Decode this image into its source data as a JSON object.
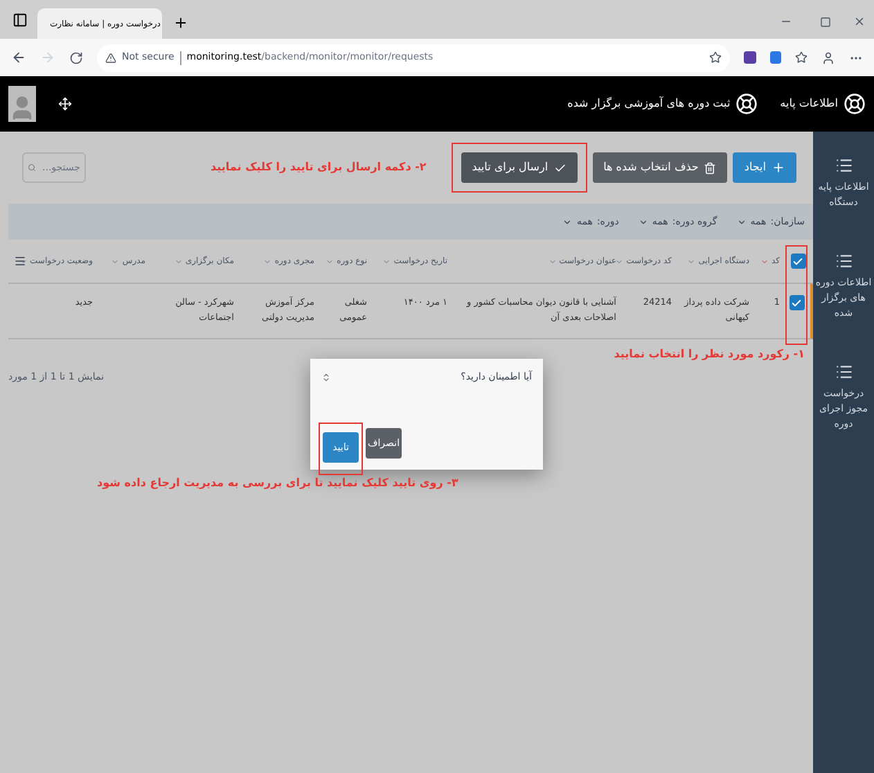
{
  "browser": {
    "tab_title": "درخواست دوره | سامانه نظارت",
    "security": "Not secure",
    "url_host": "monitoring.test",
    "url_path": "/backend/monitor/monitor/requests"
  },
  "header": {
    "nav": [
      {
        "label": "اطلاعات پایه"
      },
      {
        "label": "ثبت دوره های آموزشی برگزار شده"
      }
    ]
  },
  "toolbar": {
    "buttons": [
      {
        "kind": "create",
        "label": "ایجاد"
      },
      {
        "kind": "delete",
        "label": "حذف انتخاب شده ها"
      },
      {
        "kind": "send",
        "label": "ارسال برای تایید"
      }
    ],
    "annotation": "۲- دکمه ارسال برای تایید را کلیک نمایید",
    "search": {
      "placeholder": "جستجو..."
    }
  },
  "filters": [
    {
      "label": "سازمان:",
      "value": "همه"
    },
    {
      "label": "گروه دوره:",
      "value": "همه"
    },
    {
      "label": "دوره:",
      "value": "همه"
    }
  ],
  "table": {
    "all_checked": true,
    "columns": [
      {
        "label": "کد",
        "sorted": true
      },
      {
        "label": "دستگاه اجرایی",
        "sorted": false
      },
      {
        "label": "کد درخواست",
        "sorted": false
      },
      {
        "label": "عنوان درخواست",
        "sorted": false
      },
      {
        "label": "تاریخ درخواست",
        "sorted": false
      },
      {
        "label": "نوع دوره",
        "sorted": false
      },
      {
        "label": "مجری دوره",
        "sorted": false
      },
      {
        "label": "مکان برگزاری",
        "sorted": false
      },
      {
        "label": "مدرس",
        "sorted": false
      },
      {
        "label": "وضعیت درخواست",
        "sorted": false
      }
    ],
    "rows": [
      {
        "checked": true,
        "cells": [
          "1",
          "شرکت داده پرداز کیهانی",
          "24214",
          "آشنایی با قانون دیوان محاسبات کشور و اصلاحات بعدی آن",
          "۱ مرد ۱۴۰۰",
          "شغلی عمومی",
          "مرکز آموزش مدیریت دولتی",
          "شهرکرد - سالن اجتماعات",
          "",
          "جدید"
        ]
      }
    ]
  },
  "row_annotation": "۱- رکورد مورد نظر را انتخاب نمایید",
  "footer": "نمایش 1 تا 1 از 1 مورد",
  "dialog": {
    "message": "آیا اطمینان دارید؟",
    "buttons": [
      {
        "kind": "cancel",
        "label": "انصراف"
      },
      {
        "kind": "confirm",
        "label": "تایید"
      }
    ],
    "annotation": "۳- روی تایید کلیک نمایید تا برای بررسی به مدیریت ارجاع داده شود"
  },
  "sidebar": {
    "items": [
      {
        "label": "اطلاعات پایه دستگاه"
      },
      {
        "label": "اطلاعات دوره های برگزار شده"
      },
      {
        "label": "درخواست مجوز اجرای دوره"
      }
    ]
  }
}
